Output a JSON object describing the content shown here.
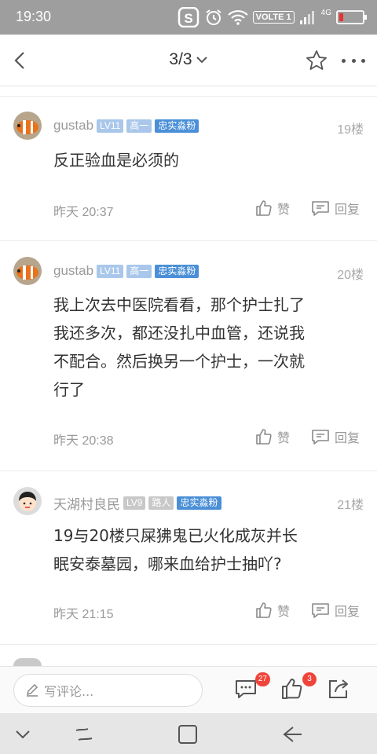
{
  "status_bar": {
    "time": "19:30",
    "volte": "VOLTE 1",
    "network": "4G",
    "icons": [
      "sogou-icon",
      "alarm-icon",
      "wifi-icon",
      "signal-icon",
      "battery-icon"
    ]
  },
  "header": {
    "page_indicator": "3/3"
  },
  "comments": [
    {
      "user": "gustab",
      "level": "LV11",
      "grade": "高一",
      "fan_badge": "忠实淼粉",
      "floor": "19楼",
      "text": "反正验血是必须的",
      "time": "昨天 20:37",
      "like_label": "赞",
      "reply_label": "回复"
    },
    {
      "user": "gustab",
      "level": "LV11",
      "grade": "高一",
      "fan_badge": "忠实淼粉",
      "floor": "20楼",
      "text_lines": [
        "我上次去中医院看看，那个护士扎了",
        "我还多次，都还没扎中血管，还说我",
        "不配合。然后换另一个护士，一次就",
        "行了"
      ],
      "time": "昨天 20:38",
      "like_label": "赞",
      "reply_label": "回复"
    },
    {
      "user": "天湖村良民",
      "level": "LV9",
      "grade": "路人",
      "fan_badge": "忠实淼粉",
      "floor": "21楼",
      "text_lines": [
        "19与20楼只屎狒鬼已火化成灰并长",
        "眠安泰墓园，哪来血给护士抽吖?"
      ],
      "time": "昨天 21:15",
      "like_label": "赞",
      "reply_label": "回复"
    }
  ],
  "bottom_bar": {
    "placeholder": "写评论...",
    "comment_count": "27",
    "like_count": "3"
  },
  "colors": {
    "status_bar": "#9e9e9e",
    "badge_light_blue": "#a9c7ea",
    "badge_blue": "#4a8fd7",
    "badge_grey": "#c8c8c8",
    "count_red": "#f0443a"
  }
}
